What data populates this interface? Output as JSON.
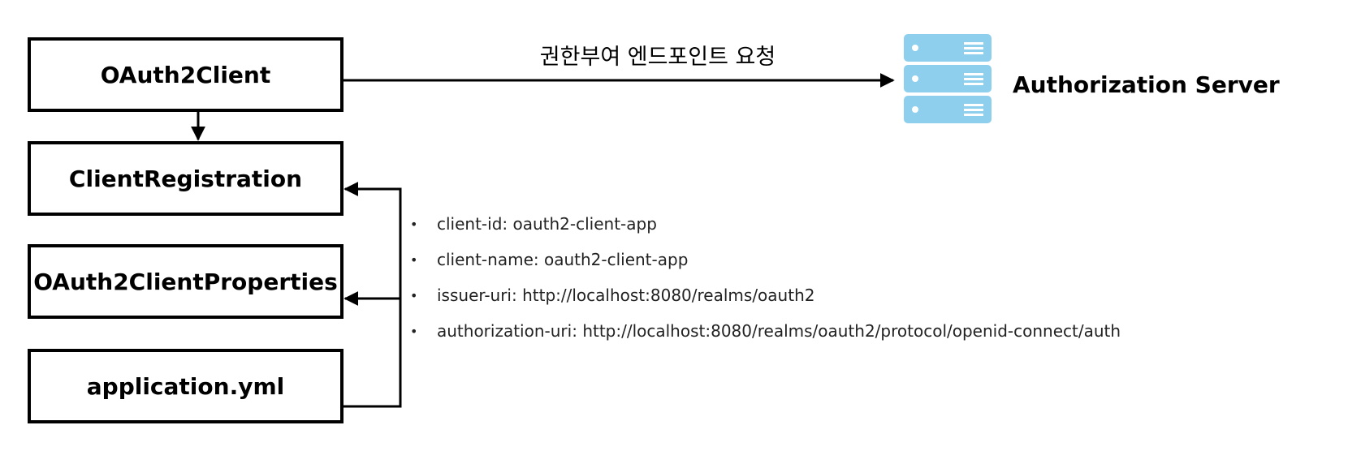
{
  "boxes": {
    "oauth2client": "OAuth2Client",
    "client_registration": "ClientRegistration",
    "client_properties": "OAuth2ClientProperties",
    "application_yml": "application.yml"
  },
  "request_label": "권한부여 엔드포인트 요청",
  "server": {
    "label": "Authorization Server",
    "icon": "server-icon",
    "color": "#8fcfee"
  },
  "properties": [
    {
      "key": "client-id:",
      "value": "oauth2-client-app"
    },
    {
      "key": "client-name:",
      "value": "oauth2-client-app"
    },
    {
      "key": "issuer-uri:",
      "value": "http://localhost:8080/realms/oauth2"
    },
    {
      "key": "authorization-uri:",
      "value": "http://localhost:8080/realms/oauth2/protocol/openid-connect/auth"
    }
  ]
}
